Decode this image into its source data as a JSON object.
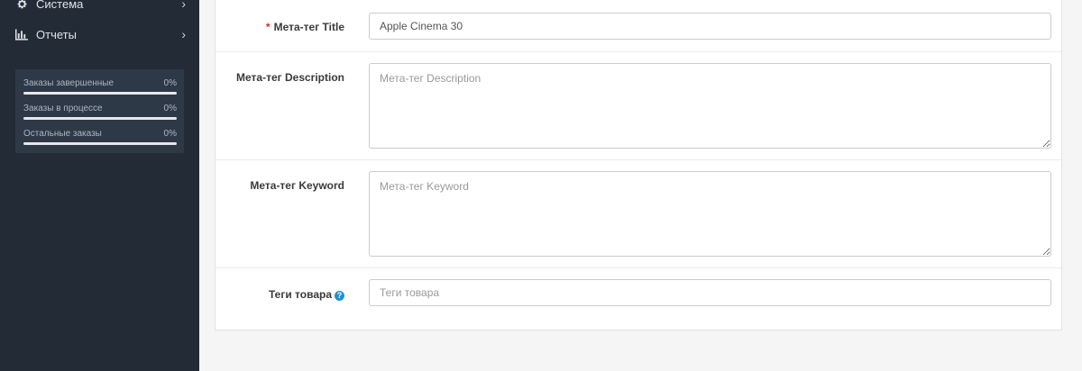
{
  "sidebar": {
    "menu": [
      {
        "label": "Система",
        "icon": "gear-icon"
      },
      {
        "label": "Отчеты",
        "icon": "bar-chart-icon"
      }
    ],
    "stats": [
      {
        "label": "Заказы завершенные",
        "value": "0%",
        "progress": 0
      },
      {
        "label": "Заказы в процессе",
        "value": "0%",
        "progress": 0
      },
      {
        "label": "Остальные заказы",
        "value": "0%",
        "progress": 0
      }
    ]
  },
  "form": {
    "meta_title": {
      "required_mark": "*",
      "label": "Мета-тег Title",
      "value": "Apple Cinema 30"
    },
    "meta_description": {
      "label": "Мета-тег Description",
      "placeholder": "Мета-тег Description",
      "value": ""
    },
    "meta_keyword": {
      "label": "Мета-тег Keyword",
      "placeholder": "Мета-тег Keyword",
      "value": ""
    },
    "product_tags": {
      "label": "Теги товара",
      "help_icon": "?",
      "placeholder": "Теги товара",
      "value": ""
    }
  }
}
